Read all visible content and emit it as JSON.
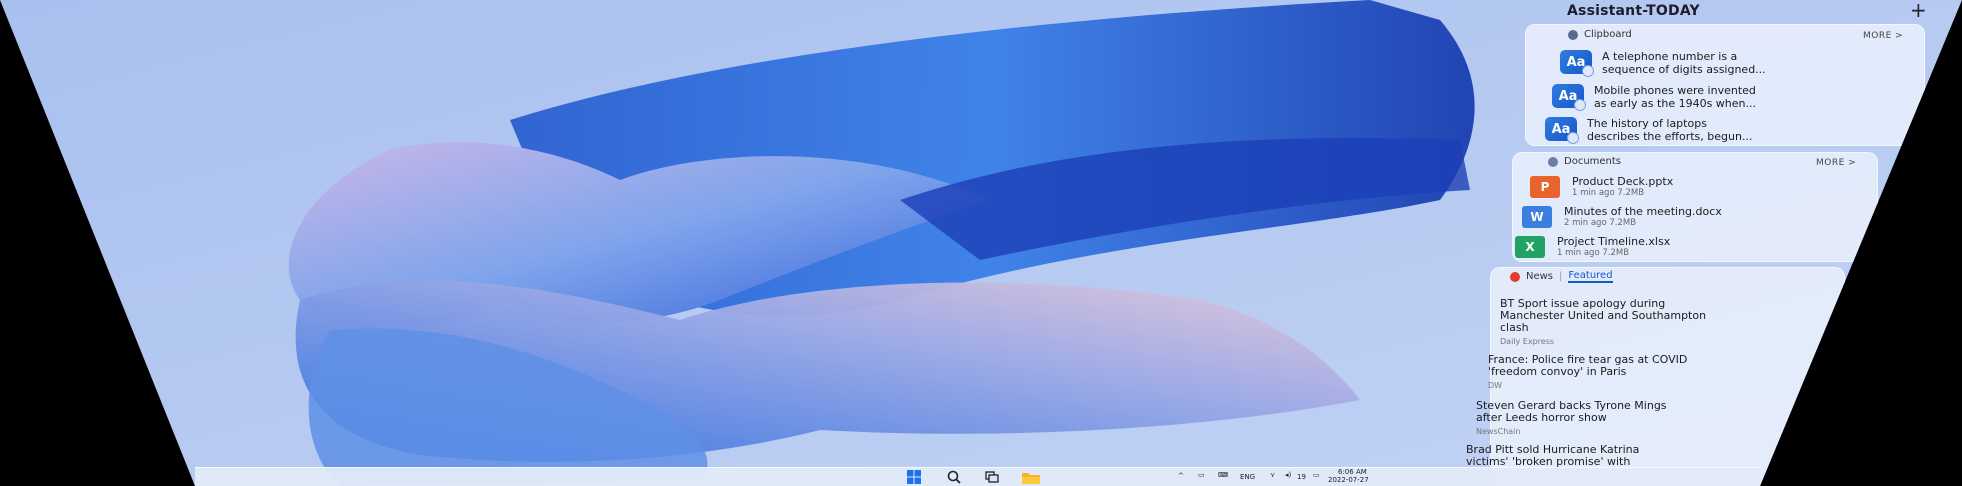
{
  "panel": {
    "title": "Assistant-TODAY",
    "add_label": "+"
  },
  "clipboard": {
    "label": "Clipboard",
    "more_label": "MORE >",
    "items": [
      {
        "icon": "text-clip-icon",
        "line1": "A telephone number is a",
        "line2": "sequence of digits assigned..."
      },
      {
        "icon": "text-clip-icon",
        "line1": "Mobile phones were invented",
        "line2": "as early as the 1940s when..."
      },
      {
        "icon": "text-clip-icon",
        "line1": "The history of laptops",
        "line2": "describes the efforts, begun..."
      }
    ]
  },
  "documents": {
    "label": "Documents",
    "more_label": "MORE >",
    "items": [
      {
        "name": "Product Deck.pptx",
        "meta": "1 min ago   7.2MB",
        "type": "pptx",
        "color": "#e8642c"
      },
      {
        "name": "Minutes of the meeting.docx",
        "meta": "2 min ago   7.2MB",
        "type": "docx",
        "color": "#3b7ee0"
      },
      {
        "name": "Project Timeline.xlsx",
        "meta": "1 min ago   7.2MB",
        "type": "xlsx",
        "color": "#21a366"
      }
    ]
  },
  "news": {
    "label": "News",
    "separator": "|",
    "tab_featured": "Featured",
    "items": [
      {
        "line1": "BT Sport issue apology during",
        "line2": "Manchester United and Southampton",
        "line3": "clash",
        "source": "Daily Express"
      },
      {
        "line1": "France: Police fire tear gas at COVID",
        "line2": "'freedom convoy' in Paris",
        "line3": "",
        "source": "DW"
      },
      {
        "line1": "Steven Gerard backs Tyrone Mings",
        "line2": "after Leeds horror show",
        "line3": "",
        "source": "NewsChain"
      },
      {
        "line1": "Brad Pitt sold Hurricane Katrina",
        "line2": "victims' 'broken promise' with",
        "line3": "",
        "source": ""
      }
    ]
  },
  "taskbar": {
    "lang": "ENG",
    "time": "6:06 AM",
    "date": "2022-07-27",
    "volume": "19"
  },
  "colors": {
    "wallpaper_bg": "#b4c8f0",
    "accent_blue": "#1556c9",
    "news_red": "#e43b2f"
  }
}
